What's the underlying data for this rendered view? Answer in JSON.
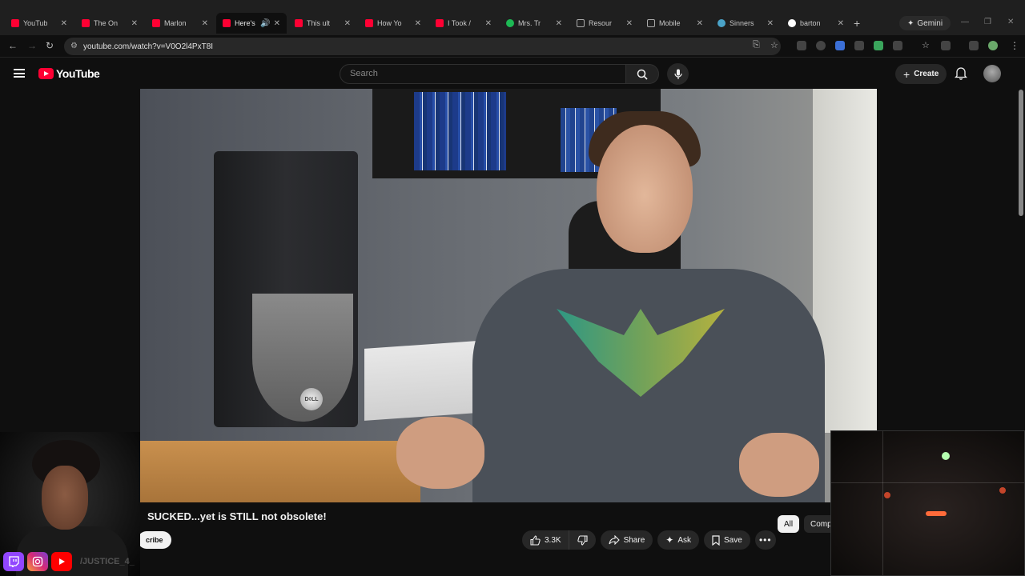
{
  "browser": {
    "tabs": [
      {
        "title": "YouTub",
        "favicon_color": "#ff0033",
        "active": false
      },
      {
        "title": "The On",
        "favicon_color": "#ff0033",
        "active": false
      },
      {
        "title": "Marlon",
        "favicon_color": "#ff0033",
        "active": false
      },
      {
        "title": "Here's",
        "favicon_color": "#ff0033",
        "active": true
      },
      {
        "title": "This ult",
        "favicon_color": "#ff0033",
        "active": false
      },
      {
        "title": "How Yo",
        "favicon_color": "#ff0033",
        "active": false
      },
      {
        "title": "I Took /",
        "favicon_color": "#ff0033",
        "active": false
      },
      {
        "title": "Mrs. Tr",
        "favicon_color": "#1db954",
        "active": false
      },
      {
        "title": "Resour",
        "favicon_color": "#222222",
        "active": false
      },
      {
        "title": "Mobile",
        "favicon_color": "#222222",
        "active": false
      },
      {
        "title": "Sinners",
        "favicon_color": "#4aa3c8",
        "active": false
      },
      {
        "title": "barton",
        "favicon_color": "#ffffff",
        "active": false
      }
    ],
    "new_tab_label": "+",
    "gemini_label": "Gemini",
    "url": "youtube.com/watch?v=V0O2l4PxT8I"
  },
  "youtube": {
    "logo_text": "YouTube",
    "search_placeholder": "Search",
    "create_label": "Create"
  },
  "video": {
    "title": "SUCKED...yet is STILL not obsolete!",
    "subscribe_label": "cribe",
    "likes": "3.3K",
    "share_label": "Share",
    "ask_label": "Ask",
    "save_label": "Save",
    "chips": [
      "All",
      "Comp"
    ]
  },
  "overlay": {
    "handle": "/JUSTICE_4_"
  }
}
